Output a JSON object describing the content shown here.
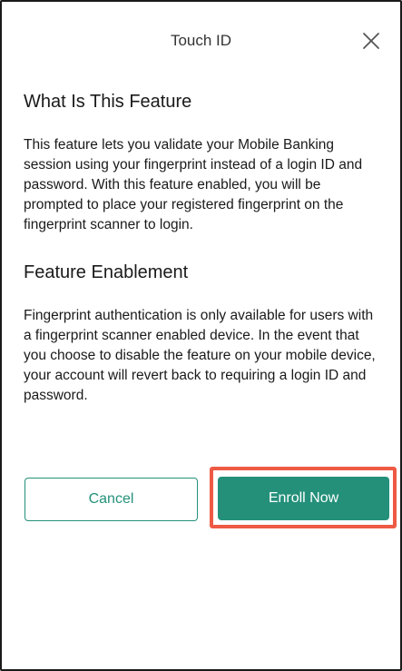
{
  "header": {
    "title": "Touch ID",
    "close_icon": "close-icon"
  },
  "sections": [
    {
      "heading": "What Is This Feature",
      "body": "This feature lets you validate your Mobile Banking session using your fingerprint instead of a login ID and password. With this feature enabled, you will be prompted to place your registered fingerprint on the fingerprint scanner to login."
    },
    {
      "heading": "Feature Enablement",
      "body": "Fingerprint authentication is only available for users with a fingerprint scanner enabled device. In the event that you choose to disable the feature on your mobile device, your account will revert back to requiring a login ID and password."
    }
  ],
  "actions": {
    "cancel_label": "Cancel",
    "enroll_label": "Enroll Now"
  },
  "colors": {
    "accent": "#24907a",
    "highlight": "#ee5a44",
    "text": "#1a1a1a"
  }
}
